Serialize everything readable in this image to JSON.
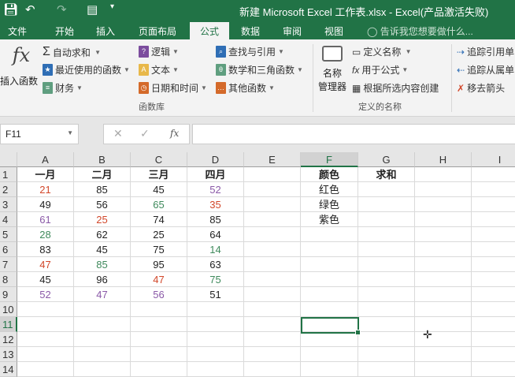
{
  "window": {
    "title": "新建 Microsoft Excel 工作表.xlsx - Excel(产品激活失败)"
  },
  "tabs": [
    "文件",
    "开始",
    "插入",
    "页面布局",
    "公式",
    "数据",
    "审阅",
    "视图"
  ],
  "tell_me": "告诉我您想要做什么...",
  "ribbon": {
    "insert_function": "插入函数",
    "autosum": "自动求和",
    "recent": "最近使用的函数",
    "financial": "财务",
    "logical": "逻辑",
    "text": "文本",
    "datetime": "日期和时间",
    "lookup": "查找与引用",
    "math": "数学和三角函数",
    "more": "其他函数",
    "group_library": "函数库",
    "name_manager_1": "名称",
    "name_manager_2": "管理器",
    "define_name": "定义名称",
    "use_in_formula": "用于公式",
    "create_from_selection": "根据所选内容创建",
    "group_names": "定义的名称",
    "trace_precedents": "追踪引用单",
    "trace_dependents": "追踪从属单",
    "remove_arrows": "移去箭头"
  },
  "formula_bar": {
    "name_box": "F11",
    "value": ""
  },
  "columns": [
    "A",
    "B",
    "C",
    "D",
    "E",
    "F",
    "G",
    "H",
    "I"
  ],
  "rows": [
    "1",
    "2",
    "3",
    "4",
    "5",
    "6",
    "7",
    "8",
    "9",
    "10",
    "11",
    "12",
    "13",
    "14"
  ],
  "colors": {
    "red": "#d2472a",
    "green": "#3f8a5c",
    "purple": "#8b5aa8",
    "black": "#222222",
    "accent": "#217346"
  },
  "cells": [
    [
      "一月",
      "二月",
      "三月",
      "四月",
      "",
      "颜色",
      "求和"
    ],
    [
      "21",
      "85",
      "45",
      "52",
      "",
      "红色",
      ""
    ],
    [
      "49",
      "56",
      "65",
      "35",
      "",
      "绿色",
      ""
    ],
    [
      "61",
      "25",
      "74",
      "85",
      "",
      "紫色",
      ""
    ],
    [
      "28",
      "62",
      "25",
      "64"
    ],
    [
      "83",
      "45",
      "75",
      "14"
    ],
    [
      "47",
      "85",
      "95",
      "63"
    ],
    [
      "45",
      "96",
      "47",
      "75"
    ],
    [
      "52",
      "47",
      "56",
      "51"
    ]
  ],
  "cell_colors": [
    [
      "black",
      "black",
      "black",
      "black",
      "black",
      "black",
      "black"
    ],
    [
      "red",
      "black",
      "black",
      "purple"
    ],
    [
      "black",
      "black",
      "green",
      "red"
    ],
    [
      "purple",
      "red",
      "black",
      "black"
    ],
    [
      "green",
      "black",
      "black",
      "black"
    ],
    [
      "black",
      "black",
      "black",
      "green"
    ],
    [
      "red",
      "green",
      "black",
      "black"
    ],
    [
      "black",
      "black",
      "red",
      "green"
    ],
    [
      "purple",
      "purple",
      "purple",
      "black"
    ]
  ]
}
